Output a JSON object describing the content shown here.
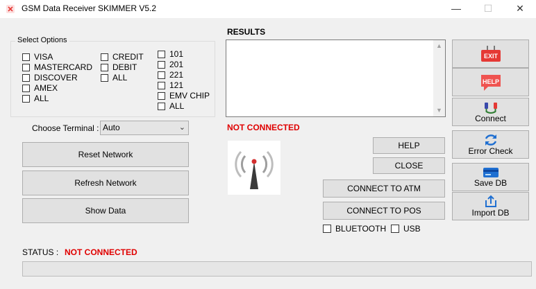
{
  "window": {
    "title": "GSM Data Receiver SKIMMER V5.2",
    "minimize_glyph": "—",
    "maximize_glyph": "☐",
    "close_glyph": "✕"
  },
  "select_options": {
    "legend": "Select Options",
    "col1": [
      "VISA",
      "MASTERCARD",
      "DISCOVER",
      "AMEX",
      "ALL"
    ],
    "col2": [
      "CREDIT",
      "DEBIT",
      "ALL"
    ],
    "col3": [
      "101",
      "201",
      "221",
      "121",
      "EMV CHIP",
      "ALL"
    ]
  },
  "terminal": {
    "label": "Choose Terminal :",
    "value": "Auto"
  },
  "left_buttons": {
    "reset": "Reset Network",
    "refresh": "Refresh Network",
    "show": "Show Data"
  },
  "results": {
    "label": "RESULTS",
    "content": ""
  },
  "connection_status": "NOT CONNECTED",
  "mid_buttons": {
    "help": "HELP",
    "close": "CLOSE",
    "connect_atm": "CONNECT TO ATM",
    "connect_pos": "CONNECT TO POS"
  },
  "transport": {
    "bluetooth": "BLUETOOTH",
    "usb": "USB"
  },
  "side_buttons": {
    "exit_badge": "EXIT",
    "help_badge": "HELP",
    "connect": "Connect",
    "error_check": "Error Check",
    "save_db": "Save DB",
    "import_db": "Import DB"
  },
  "status": {
    "label": "STATUS :",
    "value": "NOT CONNECTED"
  },
  "colors": {
    "status_red": "#e00000",
    "accent_blue": "#1f6fd1",
    "exit_red": "#e53935",
    "help_red": "#ef5350"
  }
}
